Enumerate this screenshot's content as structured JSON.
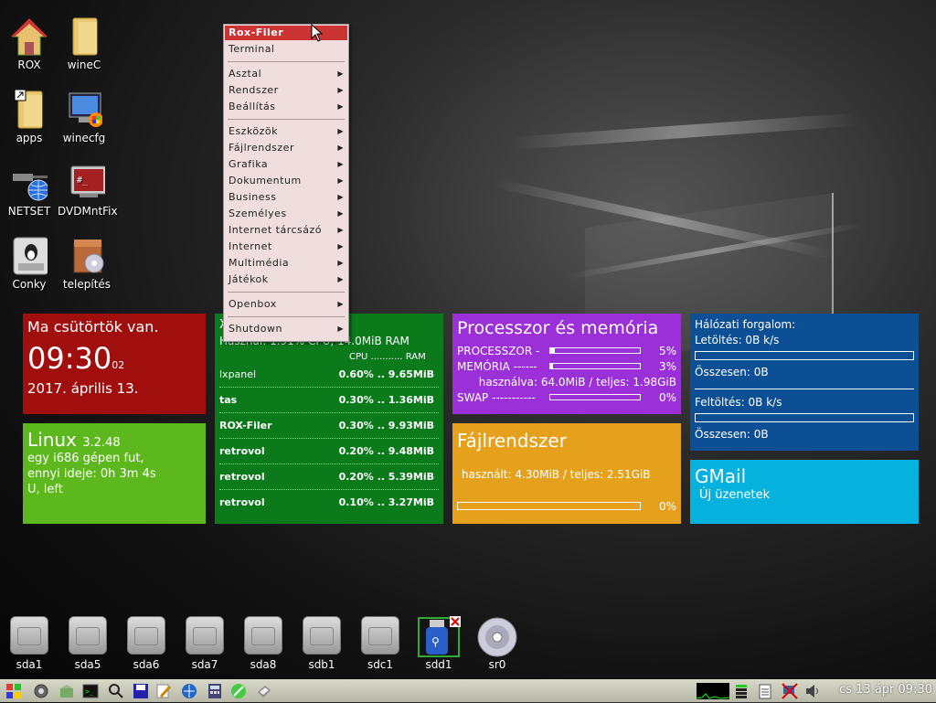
{
  "desktop_icons": [
    {
      "label": "ROX"
    },
    {
      "label": "wineC"
    },
    {
      "label": "apps"
    },
    {
      "label": "winecfg"
    },
    {
      "label": "NETSET"
    },
    {
      "label": "DVDMntFix"
    },
    {
      "label": "Conky"
    },
    {
      "label": "telepítés"
    }
  ],
  "menu": {
    "items": [
      "Rox-Filer",
      "Terminal",
      "Asztal",
      "Rendszer",
      "Beállítás",
      "Eszközök",
      "Fájlrendszer",
      "Grafika",
      "Dokumentum",
      "Business",
      "Személyes",
      "Internet tárcsázó",
      "Internet",
      "Multimédia",
      "Játékok",
      "Openbox",
      "Shutdown"
    ]
  },
  "clock_tile": {
    "day": "Ma csütörtök van.",
    "time": "09:30",
    "seconds": "02",
    "date": "2017. április 13."
  },
  "linux_tile": {
    "name": "Linux",
    "version": "3.2.48",
    "line1": "egy i686 gépen fut,",
    "line2": "ennyi ideje: 0h 3m 4s",
    "line3": "U,  left"
  },
  "process_tile": {
    "heading_prefix": "X",
    "usage": "Használ:  1.91% CPU, 14.0MiB RAM",
    "col_cpu": "CPU",
    "col_dots": "...........",
    "col_ram": "RAM",
    "rows": [
      {
        "name": "lxpanel",
        "value": "0.60% .. 9.65MiB"
      },
      {
        "name": "tas",
        "value": "0.30% .. 1.36MiB"
      },
      {
        "name": "ROX-Filer",
        "value": "0.30% .. 9.93MiB"
      },
      {
        "name": "retrovol",
        "value": "0.20% .. 9.48MiB"
      },
      {
        "name": "retrovol",
        "value": "0.20% .. 5.39MiB"
      },
      {
        "name": "retrovol",
        "value": "0.10% .. 3.27MiB"
      }
    ]
  },
  "cpu_mem_tile": {
    "title": "Processzor és memória",
    "cpu_label": "PROCESSZOR -",
    "cpu_pct": "5%",
    "cpu_level": 0.05,
    "mem_label": "MEMÓRIA ------",
    "mem_pct": "3%",
    "mem_level": 0.03,
    "used": "használva: 64.0MiB / teljes: 1.98GiB",
    "swap_label": "SWAP -----------",
    "swap_pct": "0%",
    "swap_level": 0
  },
  "fs_tile": {
    "title": "Fájlrendszer",
    "usage": "használt: 4.30MiB / teljes: 2.51GiB",
    "pct": "0%",
    "level": 0
  },
  "net_tile": {
    "title": "Hálózati forgalom:",
    "down": "Letöltés: 0B k/s",
    "down_total": "Összesen: 0B",
    "up": "Feltöltés: 0B k/s",
    "up_total": "Összesen: 0B"
  },
  "gmail_tile": {
    "title": "GMail",
    "subtitle": "Új üzenetek"
  },
  "drives": [
    "sda1",
    "sda5",
    "sda6",
    "sda7",
    "sda8",
    "sdb1",
    "sdc1",
    "sdd1",
    "sr0"
  ],
  "taskbar": {
    "clock": "cs 13 ápr 09:30"
  }
}
